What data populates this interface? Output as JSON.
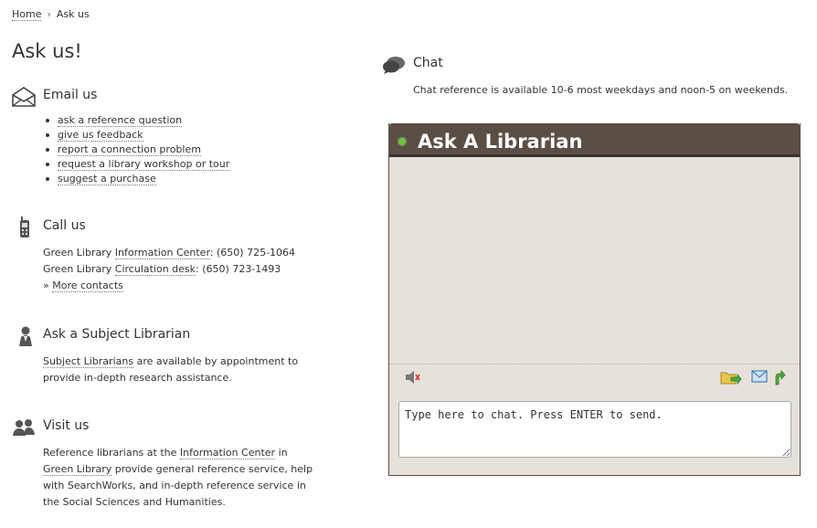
{
  "breadcrumb": {
    "home": "Home",
    "separator": "›",
    "current": "Ask us"
  },
  "page_title": "Ask us!",
  "email": {
    "heading": "Email us",
    "icon": "envelope-icon",
    "links": [
      "ask a reference question",
      "give us feedback",
      "report a connection problem",
      "request a library workshop or tour",
      "suggest a purchase"
    ]
  },
  "call": {
    "heading": "Call us",
    "icon": "phone-icon",
    "line1_prefix": "Green Library ",
    "line1_link": "Information Center",
    "line1_suffix": ": (650) 725-1064",
    "line2_prefix": "Green Library ",
    "line2_link": "Circulation desk",
    "line2_suffix": ": (650) 723-1493",
    "more_prefix": "» ",
    "more_link": "More contacts"
  },
  "subject": {
    "heading": "Ask a Subject Librarian",
    "icon": "person-icon",
    "link": "Subject Librarians",
    "text_after_link": " are available by appointment to",
    "text_line2": "provide in-depth research assistance."
  },
  "visit": {
    "heading": "Visit us",
    "icon": "people-icon",
    "l1_text": "Reference librarians at the ",
    "l1_link": "Information Center",
    "l1_tail": " in",
    "l2_link": "Green Library",
    "l2_tail": " provide general reference service, help",
    "l3": "with SearchWorks, and in-depth reference service in",
    "l4": "the Social Sciences and Humanities."
  },
  "chat": {
    "heading": "Chat",
    "icon": "chat-bubbles-icon",
    "description": "Chat reference is available 10-6 most weekdays and noon-5 on weekends.",
    "widget_title": "Ask A Librarian",
    "input_placeholder": "Type here to chat. Press ENTER to send.",
    "status_color": "#6cc33a",
    "header_color": "#5b4e44",
    "panel_color": "#e6e1da",
    "toolbar_icons": [
      "speaker-icon",
      "send-file-icon",
      "email-transcript-icon",
      "popout-icon"
    ]
  }
}
